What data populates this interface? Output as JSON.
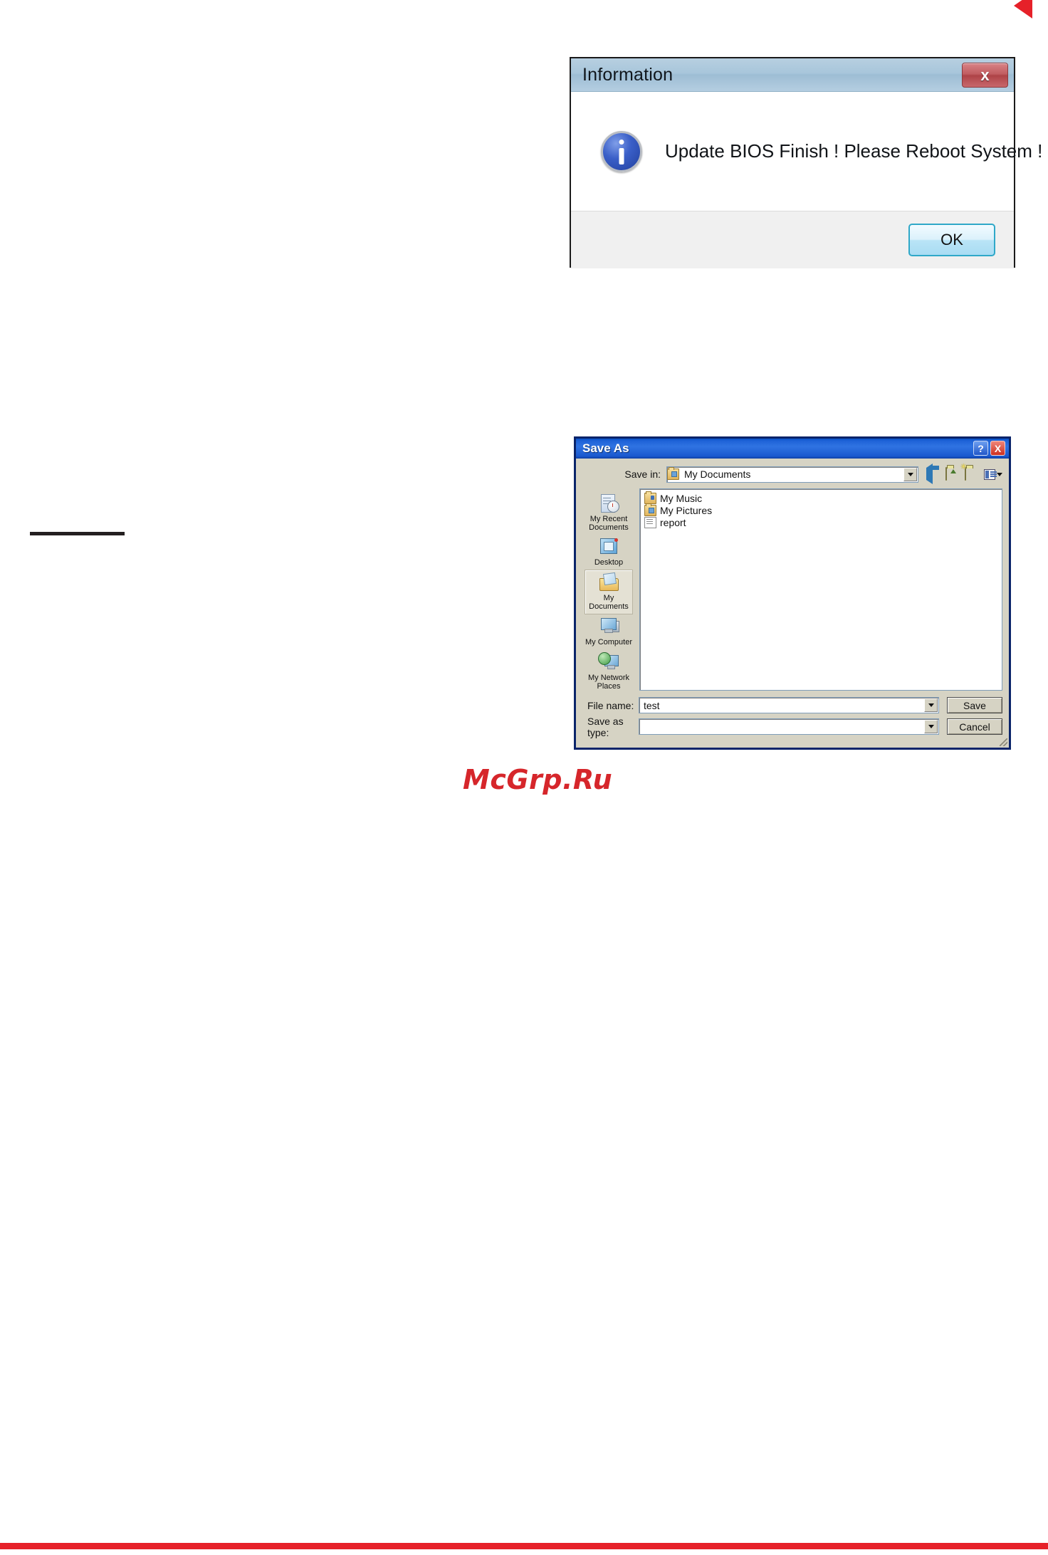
{
  "page": {
    "watermark": "McGrp.Ru",
    "corner_arrow_icon": "left-chevron-arrow-icon",
    "accent_red": "#e62129",
    "rule_color": "#231f20"
  },
  "info_dialog": {
    "title": "Information",
    "message": "Update BIOS Finish ! Please Reboot System !",
    "icon": "information-icon",
    "close_label": "x",
    "ok_label": "OK"
  },
  "save_as_dialog": {
    "title": "Save As",
    "help_label": "?",
    "close_label": "X",
    "save_in": {
      "label": "Save in:",
      "value": "My Documents"
    },
    "toolbar": [
      {
        "name": "back-icon",
        "tooltip": "Back"
      },
      {
        "name": "up-one-level-icon",
        "tooltip": "Up One Level"
      },
      {
        "name": "new-folder-icon",
        "tooltip": "Create New Folder"
      },
      {
        "name": "views-icon",
        "tooltip": "Views"
      }
    ],
    "places": [
      {
        "label": "My Recent Documents",
        "icon": "recent-documents-icon",
        "selected": false
      },
      {
        "label": "Desktop",
        "icon": "desktop-icon",
        "selected": false
      },
      {
        "label": "My Documents",
        "icon": "my-documents-icon",
        "selected": true
      },
      {
        "label": "My Computer",
        "icon": "my-computer-icon",
        "selected": false
      },
      {
        "label": "My Network Places",
        "icon": "my-network-places-icon",
        "selected": false
      }
    ],
    "files": [
      {
        "name": "My Music",
        "icon": "music-folder-icon"
      },
      {
        "name": "My Pictures",
        "icon": "pictures-folder-icon"
      },
      {
        "name": "report",
        "icon": "text-document-icon"
      }
    ],
    "file_name": {
      "label": "File name:",
      "value": "test"
    },
    "save_as_type": {
      "label": "Save as type:",
      "value": ""
    },
    "save_label": "Save",
    "cancel_label": "Cancel"
  }
}
